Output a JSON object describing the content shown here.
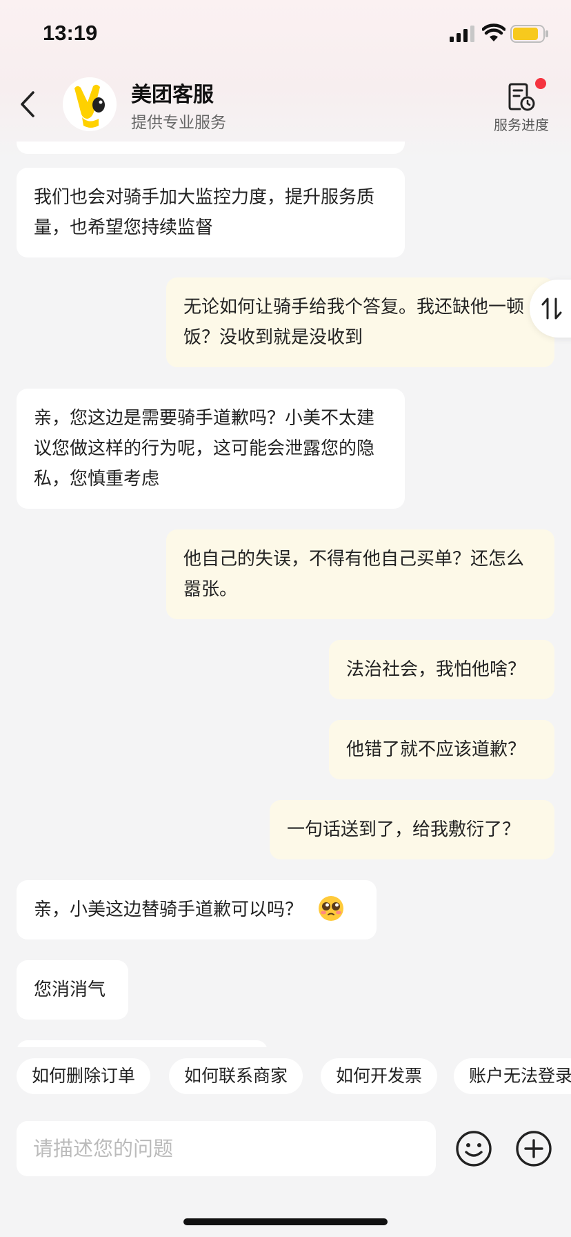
{
  "status_bar": {
    "time": "13:19"
  },
  "header": {
    "title": "美团客服",
    "subtitle": "提供专业服务",
    "progress_label": "服务进度"
  },
  "messages": [
    {
      "from": "agent",
      "text": "我们也会对骑手加大监控力度，提升服务质量，也希望您持续监督"
    },
    {
      "from": "user",
      "text": "无论如何让骑手给我个答复。我还缺他一顿饭？没收到就是没收到"
    },
    {
      "from": "agent",
      "text": "亲，您这边是需要骑手道歉吗？小美不太建议您做这样的行为呢，这可能会泄露您的隐私，您慎重考虑"
    },
    {
      "from": "user",
      "text": "他自己的失误，不得有他自己买单？还怎么嚣张。"
    },
    {
      "from": "user",
      "text": "法治社会，我怕他啥？"
    },
    {
      "from": "user",
      "text": "他错了就不应该道歉？"
    },
    {
      "from": "user",
      "text": "一句话送到了，给我敷衍了？"
    },
    {
      "from": "agent",
      "text": "亲，小美这边替骑手道歉可以吗？",
      "emoji": "pleading-face-icon"
    },
    {
      "from": "agent",
      "text": "您消消气"
    }
  ],
  "quick_replies": [
    "如何删除订单",
    "如何联系商家",
    "如何开发票",
    "账户无法登录"
  ],
  "input": {
    "placeholder": "请描述您的问题",
    "value": ""
  },
  "colors": {
    "user_bubble": "#fdf9e8",
    "agent_bubble": "#ffffff",
    "background": "#f4f4f5",
    "badge_red": "#f5333f",
    "battery_yellow": "#f7c91d",
    "brand_yellow": "#ffd100"
  },
  "icons": {
    "back": "chevron-left-icon",
    "avatar": "meituan-mascot-icon",
    "progress": "document-clock-icon",
    "swap": "swap-arrows-icon",
    "emoji": "smiley-icon",
    "plus": "plus-circle-icon"
  }
}
